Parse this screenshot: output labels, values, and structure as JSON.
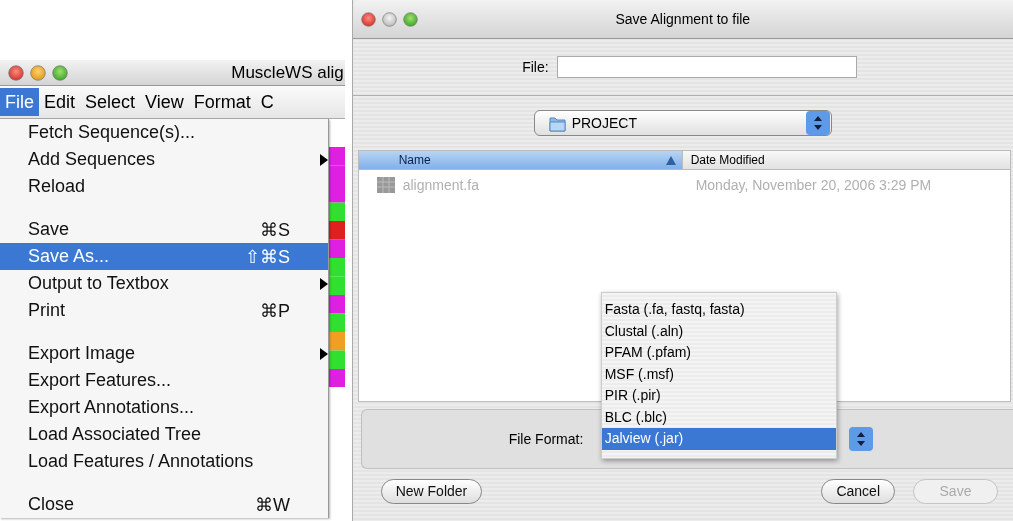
{
  "main_window": {
    "title": "MuscleWS alig",
    "menubar": [
      {
        "label": "File",
        "selected": true
      },
      {
        "label": "Edit",
        "selected": false
      },
      {
        "label": "Select",
        "selected": false
      },
      {
        "label": "View",
        "selected": false
      },
      {
        "label": "Format",
        "selected": false
      },
      {
        "label": "C",
        "selected": false
      }
    ],
    "file_menu": [
      {
        "label": "Fetch Sequence(s)...",
        "separator_before": false,
        "submenu": false,
        "selected": false
      },
      {
        "label": "Add Sequences",
        "separator_before": false,
        "submenu": true,
        "selected": false
      },
      {
        "label": "Reload",
        "separator_before": false,
        "submenu": false,
        "selected": false
      },
      {
        "label": "Save",
        "shortcut": "⌘S",
        "separator_before": true,
        "submenu": false,
        "selected": false
      },
      {
        "label": "Save As...",
        "shortcut": "⇧⌘S",
        "separator_before": false,
        "submenu": false,
        "selected": true
      },
      {
        "label": "Output to Textbox",
        "separator_before": false,
        "submenu": true,
        "selected": false
      },
      {
        "label": "Print",
        "shortcut": "⌘P",
        "separator_before": false,
        "submenu": false,
        "selected": false
      },
      {
        "label": "Export Image",
        "separator_before": true,
        "submenu": true,
        "selected": false
      },
      {
        "label": "Export Features...",
        "separator_before": false,
        "submenu": false,
        "selected": false
      },
      {
        "label": "Export Annotations...",
        "separator_before": false,
        "submenu": false,
        "selected": false
      },
      {
        "label": "Load Associated Tree",
        "separator_before": false,
        "submenu": false,
        "selected": false
      },
      {
        "label": "Load Features / Annotations",
        "separator_before": false,
        "submenu": false,
        "selected": false
      },
      {
        "label": "Close",
        "shortcut": "⌘W",
        "separator_before": true,
        "submenu": false,
        "selected": false
      }
    ]
  },
  "dialog": {
    "title": "Save Alignment to file",
    "file_label": "File:",
    "folder": "PROJECT",
    "columns": [
      {
        "label": "Name",
        "selected": true
      },
      {
        "label": "Date Modified",
        "selected": false
      }
    ],
    "files": [
      {
        "name": "alignment.fa",
        "modified": "Monday, November 20, 2006 3:29 PM",
        "disabled": true
      }
    ],
    "format_label": "File Format:",
    "format_options": [
      {
        "label": "Fasta (.fa, fastq, fasta)",
        "selected": false
      },
      {
        "label": "Clustal (.aln)",
        "selected": false
      },
      {
        "label": "PFAM (.pfam)",
        "selected": false
      },
      {
        "label": "MSF (.msf)",
        "selected": false
      },
      {
        "label": "PIR (.pir)",
        "selected": false
      },
      {
        "label": "BLC (.blc)",
        "selected": false
      },
      {
        "label": "Jalview (.jar)",
        "selected": true
      }
    ],
    "buttons": [
      {
        "label": "New Folder",
        "disabled": false,
        "kind": "left"
      },
      {
        "label": "Cancel",
        "disabled": false,
        "kind": "right"
      },
      {
        "label": "Save",
        "disabled": true,
        "kind": "right"
      }
    ]
  }
}
